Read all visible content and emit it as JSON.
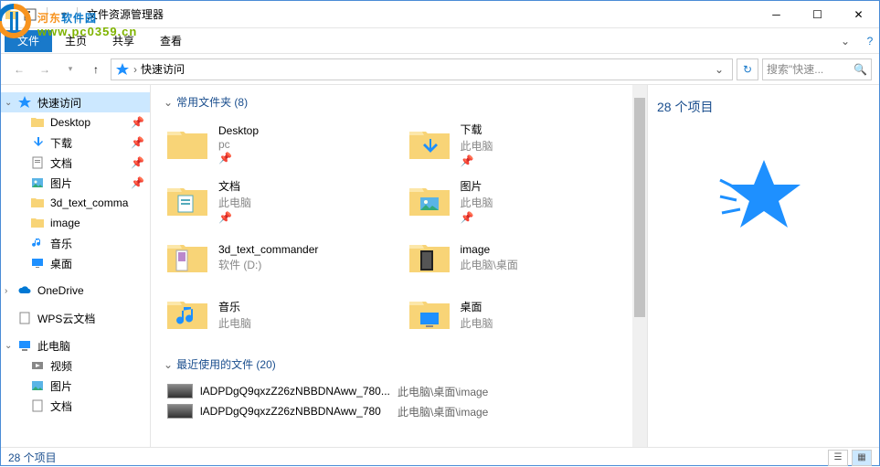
{
  "window": {
    "title": "文件资源管理器"
  },
  "ribbon": {
    "file": "文件",
    "tabs": [
      "主页",
      "共享",
      "查看"
    ]
  },
  "nav": {
    "crumb": "快速访问",
    "search_placeholder": "搜索\"快速..."
  },
  "sidebar": {
    "quick_access": "快速访问",
    "items": [
      {
        "label": "Desktop",
        "pinned": true,
        "icon": "desktop"
      },
      {
        "label": "下载",
        "pinned": true,
        "icon": "downloads"
      },
      {
        "label": "文档",
        "pinned": true,
        "icon": "documents"
      },
      {
        "label": "图片",
        "pinned": true,
        "icon": "pictures"
      },
      {
        "label": "3d_text_comma",
        "pinned": false,
        "icon": "folder"
      },
      {
        "label": "image",
        "pinned": false,
        "icon": "folder"
      },
      {
        "label": "音乐",
        "pinned": false,
        "icon": "music"
      },
      {
        "label": "桌面",
        "pinned": false,
        "icon": "desktop2"
      }
    ],
    "onedrive": "OneDrive",
    "wps": "WPS云文档",
    "this_pc": "此电脑",
    "pc_items": [
      {
        "label": "视频",
        "icon": "videos"
      },
      {
        "label": "图片",
        "icon": "pictures"
      },
      {
        "label": "文档",
        "icon": "documents"
      }
    ]
  },
  "main": {
    "freq_header": "常用文件夹 (8)",
    "recent_header": "最近使用的文件 (20)",
    "folders": [
      {
        "name": "Desktop",
        "sub": "pc",
        "pinned": true,
        "icon": "plain"
      },
      {
        "name": "下载",
        "sub": "此电脑",
        "pinned": true,
        "icon": "downloads"
      },
      {
        "name": "文档",
        "sub": "此电脑",
        "pinned": true,
        "icon": "documents"
      },
      {
        "name": "图片",
        "sub": "此电脑",
        "pinned": true,
        "icon": "pictures"
      },
      {
        "name": "3d_text_commander",
        "sub": "软件 (D:)",
        "pinned": false,
        "icon": "preview"
      },
      {
        "name": "image",
        "sub": "此电脑\\桌面",
        "pinned": false,
        "icon": "preview2"
      },
      {
        "name": "音乐",
        "sub": "此电脑",
        "pinned": false,
        "icon": "music"
      },
      {
        "name": "桌面",
        "sub": "此电脑",
        "pinned": false,
        "icon": "desktop"
      }
    ],
    "recent": [
      {
        "name": "lADPDgQ9qxzZ26zNBBDNAww_780...",
        "path": "此电脑\\桌面\\image"
      },
      {
        "name": "lADPDgQ9qxzZ26zNBBDNAww_780",
        "path": "此电脑\\桌面\\image"
      }
    ]
  },
  "preview": {
    "title": "28 个项目"
  },
  "status": {
    "text": "28 个项目"
  },
  "watermark": {
    "main_cn": "河东软件园",
    "url": "www.pc0359.cn"
  }
}
